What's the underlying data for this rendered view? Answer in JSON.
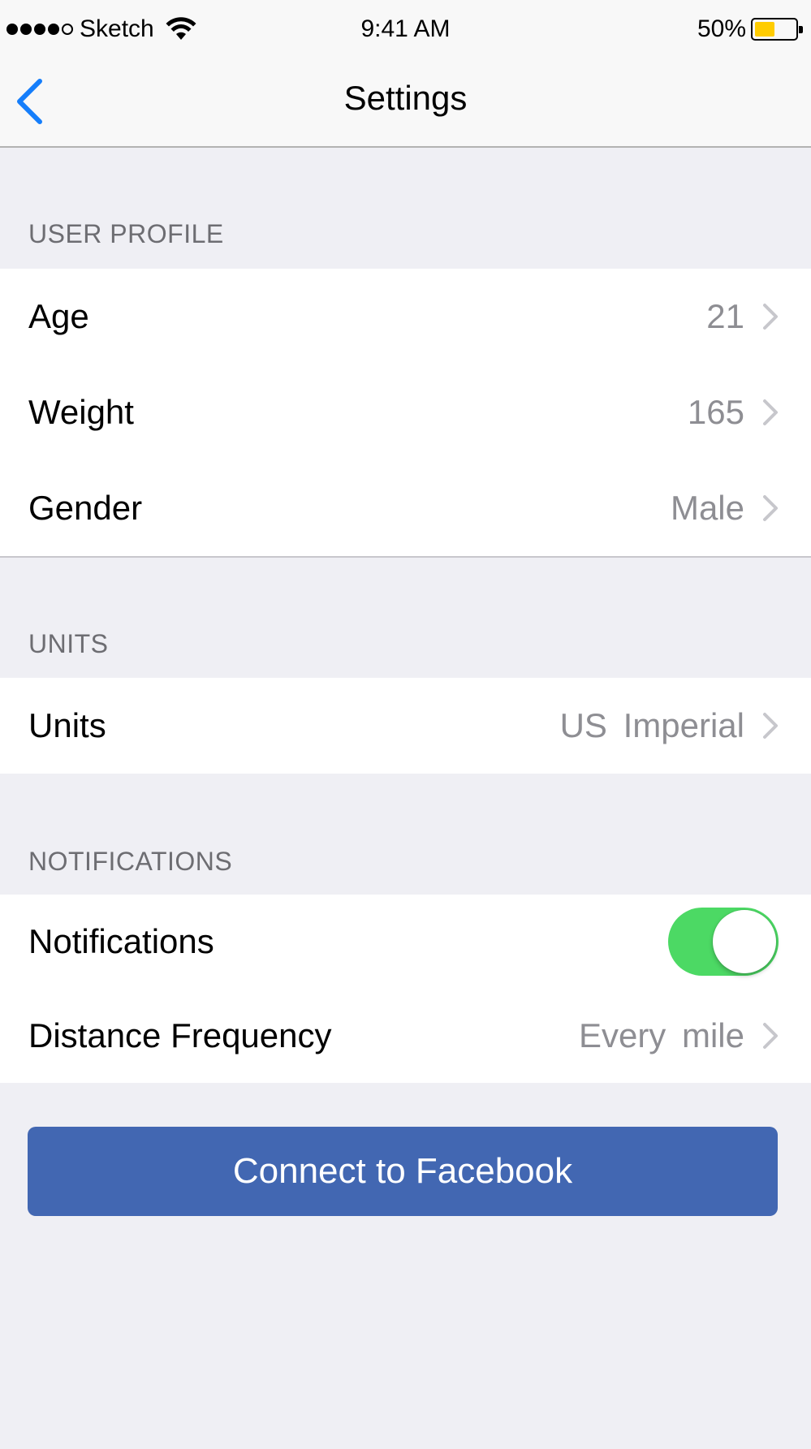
{
  "status_bar": {
    "carrier": "Sketch",
    "time": "9:41 AM",
    "battery_percent": "50%",
    "battery_level": 0.5,
    "battery_color": "#ffcc00",
    "signal_bars_filled": 4,
    "signal_bars_total": 5
  },
  "nav": {
    "title": "Settings",
    "back_icon": "chevron-left-icon",
    "accent_color": "#157efb"
  },
  "sections": {
    "user_profile": {
      "header": "USER PROFILE",
      "rows": [
        {
          "label": "Age",
          "value": "21"
        },
        {
          "label": "Weight",
          "value": "165"
        },
        {
          "label": "Gender",
          "value": "Male"
        }
      ]
    },
    "units": {
      "header": "UNITS",
      "rows": [
        {
          "label": "Units",
          "value": "US Imperial"
        }
      ]
    },
    "notifications": {
      "header": "NOTIFICATIONS",
      "toggle_row": {
        "label": "Notifications",
        "on": true,
        "on_color": "#4cd964"
      },
      "rows": [
        {
          "label": "Distance Frequency",
          "value": "Every mile"
        }
      ]
    }
  },
  "facebook_button": {
    "label": "Connect to Facebook",
    "color": "#4267b2"
  }
}
